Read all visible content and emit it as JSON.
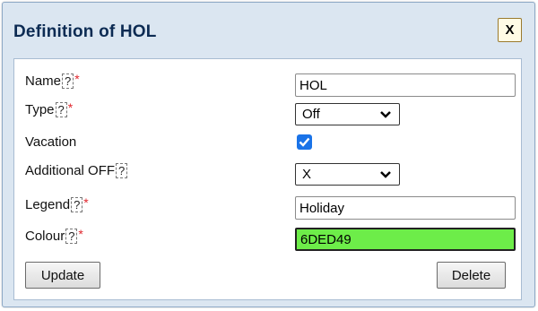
{
  "dialog": {
    "title": "Definition of HOL",
    "close_label": "X"
  },
  "form": {
    "help_glyph": "?",
    "required_mark": "*",
    "name": {
      "label": "Name",
      "value": "HOL"
    },
    "type": {
      "label": "Type",
      "value": "Off"
    },
    "vacation": {
      "label": "Vacation",
      "checked": true
    },
    "additional_off": {
      "label": "Additional OFF",
      "value": "X"
    },
    "legend": {
      "label": "Legend",
      "value": "Holiday"
    },
    "colour": {
      "label": "Colour",
      "value": "6DED49",
      "swatch": "#6DED49"
    }
  },
  "buttons": {
    "update": "Update",
    "delete": "Delete"
  },
  "colors": {
    "title": "#0C2B53",
    "dialog_bg": "#DBE6F1",
    "required": "#E0262D",
    "checkbox": "#1A73E8"
  }
}
